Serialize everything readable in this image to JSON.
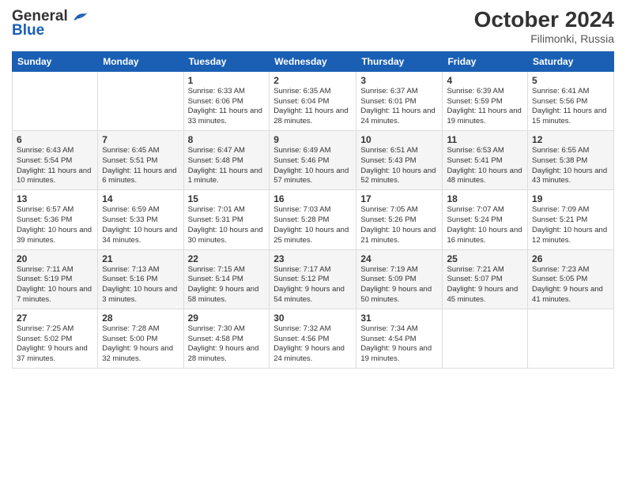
{
  "header": {
    "logo_line1": "General",
    "logo_line2": "Blue",
    "month": "October 2024",
    "location": "Filimonki, Russia"
  },
  "days_of_week": [
    "Sunday",
    "Monday",
    "Tuesday",
    "Wednesday",
    "Thursday",
    "Friday",
    "Saturday"
  ],
  "weeks": [
    [
      {
        "day": "",
        "sunrise": "",
        "sunset": "",
        "daylight": ""
      },
      {
        "day": "",
        "sunrise": "",
        "sunset": "",
        "daylight": ""
      },
      {
        "day": "1",
        "sunrise": "Sunrise: 6:33 AM",
        "sunset": "Sunset: 6:06 PM",
        "daylight": "Daylight: 11 hours and 33 minutes."
      },
      {
        "day": "2",
        "sunrise": "Sunrise: 6:35 AM",
        "sunset": "Sunset: 6:04 PM",
        "daylight": "Daylight: 11 hours and 28 minutes."
      },
      {
        "day": "3",
        "sunrise": "Sunrise: 6:37 AM",
        "sunset": "Sunset: 6:01 PM",
        "daylight": "Daylight: 11 hours and 24 minutes."
      },
      {
        "day": "4",
        "sunrise": "Sunrise: 6:39 AM",
        "sunset": "Sunset: 5:59 PM",
        "daylight": "Daylight: 11 hours and 19 minutes."
      },
      {
        "day": "5",
        "sunrise": "Sunrise: 6:41 AM",
        "sunset": "Sunset: 5:56 PM",
        "daylight": "Daylight: 11 hours and 15 minutes."
      }
    ],
    [
      {
        "day": "6",
        "sunrise": "Sunrise: 6:43 AM",
        "sunset": "Sunset: 5:54 PM",
        "daylight": "Daylight: 11 hours and 10 minutes."
      },
      {
        "day": "7",
        "sunrise": "Sunrise: 6:45 AM",
        "sunset": "Sunset: 5:51 PM",
        "daylight": "Daylight: 11 hours and 6 minutes."
      },
      {
        "day": "8",
        "sunrise": "Sunrise: 6:47 AM",
        "sunset": "Sunset: 5:48 PM",
        "daylight": "Daylight: 11 hours and 1 minute."
      },
      {
        "day": "9",
        "sunrise": "Sunrise: 6:49 AM",
        "sunset": "Sunset: 5:46 PM",
        "daylight": "Daylight: 10 hours and 57 minutes."
      },
      {
        "day": "10",
        "sunrise": "Sunrise: 6:51 AM",
        "sunset": "Sunset: 5:43 PM",
        "daylight": "Daylight: 10 hours and 52 minutes."
      },
      {
        "day": "11",
        "sunrise": "Sunrise: 6:53 AM",
        "sunset": "Sunset: 5:41 PM",
        "daylight": "Daylight: 10 hours and 48 minutes."
      },
      {
        "day": "12",
        "sunrise": "Sunrise: 6:55 AM",
        "sunset": "Sunset: 5:38 PM",
        "daylight": "Daylight: 10 hours and 43 minutes."
      }
    ],
    [
      {
        "day": "13",
        "sunrise": "Sunrise: 6:57 AM",
        "sunset": "Sunset: 5:36 PM",
        "daylight": "Daylight: 10 hours and 39 minutes."
      },
      {
        "day": "14",
        "sunrise": "Sunrise: 6:59 AM",
        "sunset": "Sunset: 5:33 PM",
        "daylight": "Daylight: 10 hours and 34 minutes."
      },
      {
        "day": "15",
        "sunrise": "Sunrise: 7:01 AM",
        "sunset": "Sunset: 5:31 PM",
        "daylight": "Daylight: 10 hours and 30 minutes."
      },
      {
        "day": "16",
        "sunrise": "Sunrise: 7:03 AM",
        "sunset": "Sunset: 5:28 PM",
        "daylight": "Daylight: 10 hours and 25 minutes."
      },
      {
        "day": "17",
        "sunrise": "Sunrise: 7:05 AM",
        "sunset": "Sunset: 5:26 PM",
        "daylight": "Daylight: 10 hours and 21 minutes."
      },
      {
        "day": "18",
        "sunrise": "Sunrise: 7:07 AM",
        "sunset": "Sunset: 5:24 PM",
        "daylight": "Daylight: 10 hours and 16 minutes."
      },
      {
        "day": "19",
        "sunrise": "Sunrise: 7:09 AM",
        "sunset": "Sunset: 5:21 PM",
        "daylight": "Daylight: 10 hours and 12 minutes."
      }
    ],
    [
      {
        "day": "20",
        "sunrise": "Sunrise: 7:11 AM",
        "sunset": "Sunset: 5:19 PM",
        "daylight": "Daylight: 10 hours and 7 minutes."
      },
      {
        "day": "21",
        "sunrise": "Sunrise: 7:13 AM",
        "sunset": "Sunset: 5:16 PM",
        "daylight": "Daylight: 10 hours and 3 minutes."
      },
      {
        "day": "22",
        "sunrise": "Sunrise: 7:15 AM",
        "sunset": "Sunset: 5:14 PM",
        "daylight": "Daylight: 9 hours and 58 minutes."
      },
      {
        "day": "23",
        "sunrise": "Sunrise: 7:17 AM",
        "sunset": "Sunset: 5:12 PM",
        "daylight": "Daylight: 9 hours and 54 minutes."
      },
      {
        "day": "24",
        "sunrise": "Sunrise: 7:19 AM",
        "sunset": "Sunset: 5:09 PM",
        "daylight": "Daylight: 9 hours and 50 minutes."
      },
      {
        "day": "25",
        "sunrise": "Sunrise: 7:21 AM",
        "sunset": "Sunset: 5:07 PM",
        "daylight": "Daylight: 9 hours and 45 minutes."
      },
      {
        "day": "26",
        "sunrise": "Sunrise: 7:23 AM",
        "sunset": "Sunset: 5:05 PM",
        "daylight": "Daylight: 9 hours and 41 minutes."
      }
    ],
    [
      {
        "day": "27",
        "sunrise": "Sunrise: 7:25 AM",
        "sunset": "Sunset: 5:02 PM",
        "daylight": "Daylight: 9 hours and 37 minutes."
      },
      {
        "day": "28",
        "sunrise": "Sunrise: 7:28 AM",
        "sunset": "Sunset: 5:00 PM",
        "daylight": "Daylight: 9 hours and 32 minutes."
      },
      {
        "day": "29",
        "sunrise": "Sunrise: 7:30 AM",
        "sunset": "Sunset: 4:58 PM",
        "daylight": "Daylight: 9 hours and 28 minutes."
      },
      {
        "day": "30",
        "sunrise": "Sunrise: 7:32 AM",
        "sunset": "Sunset: 4:56 PM",
        "daylight": "Daylight: 9 hours and 24 minutes."
      },
      {
        "day": "31",
        "sunrise": "Sunrise: 7:34 AM",
        "sunset": "Sunset: 4:54 PM",
        "daylight": "Daylight: 9 hours and 19 minutes."
      },
      {
        "day": "",
        "sunrise": "",
        "sunset": "",
        "daylight": ""
      },
      {
        "day": "",
        "sunrise": "",
        "sunset": "",
        "daylight": ""
      }
    ]
  ]
}
